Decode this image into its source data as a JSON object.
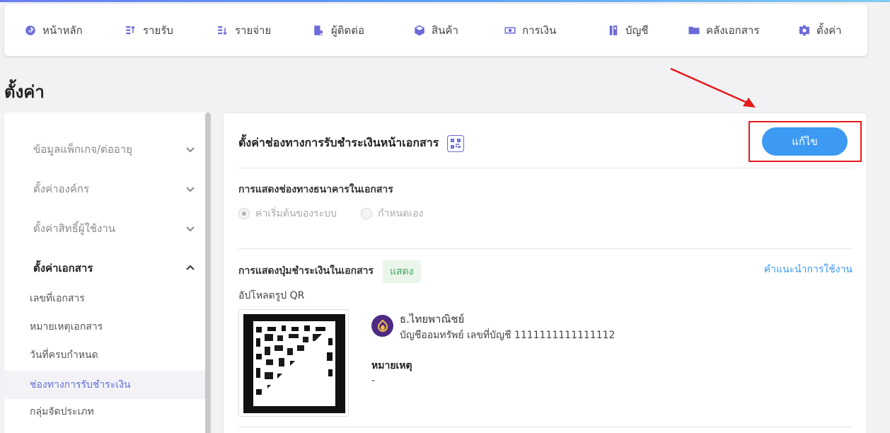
{
  "nav": {
    "items": [
      {
        "label": "หน้าหลัก",
        "icon": "dashboard-icon"
      },
      {
        "label": "รายรับ",
        "icon": "income-icon"
      },
      {
        "label": "รายจ่าย",
        "icon": "expense-icon"
      },
      {
        "label": "ผู้ติดต่อ",
        "icon": "contacts-icon"
      },
      {
        "label": "สินค้า",
        "icon": "box-icon"
      },
      {
        "label": "การเงิน",
        "icon": "money-icon"
      },
      {
        "label": "บัญชี",
        "icon": "ledger-icon"
      },
      {
        "label": "คลังเอกสาร",
        "icon": "folder-icon"
      },
      {
        "label": "ตั้งค่า",
        "icon": "gear-icon"
      }
    ]
  },
  "page": {
    "title": "ตั้งค่า"
  },
  "sidebar": {
    "groups": [
      {
        "label": "ข้อมูลแพ็กเกจ/ต่ออายุ",
        "expanded": false
      },
      {
        "label": "ตั้งค่าองค์กร",
        "expanded": false
      },
      {
        "label": "ตั้งค่าสิทธิ์ผู้ใช้งาน",
        "expanded": false
      },
      {
        "label": "ตั้งค่าเอกสาร",
        "expanded": true
      }
    ],
    "sub_items": [
      {
        "label": "เลขที่เอกสาร"
      },
      {
        "label": "หมายเหตุเอกสาร"
      },
      {
        "label": "วันที่ครบกำหนด"
      },
      {
        "label": "ช่องทางการรับชำระเงิน",
        "selected": true
      },
      {
        "label": "กลุ่มจัดประเภท"
      }
    ]
  },
  "card": {
    "title": "ตั้งค่าช่องทางการรับชำระเงินหน้าเอกสาร",
    "edit_label": "แก้ไข",
    "bank_section": {
      "label": "การแสดงช่องทางธนาคารในเอกสาร",
      "options": [
        {
          "label": "ค่าเริ่มต้นของระบบ",
          "checked": true
        },
        {
          "label": "กำหนดเอง",
          "checked": false
        }
      ]
    },
    "payment_section": {
      "label": "การแสดงปุ่มชำระเงินในเอกสาร",
      "badge": "แสดง",
      "help_link": "คำแนะนำการใช้งาน",
      "upload_label": "อัปโหลดรูป QR"
    },
    "bank": {
      "name": "ธ.ไทยพาณิชย์",
      "account": "บัญชีออมทรัพย์ เลขที่บัญชี 1111111111111112",
      "note_label": "หมายเหตุ",
      "note_value": "-"
    }
  },
  "colors": {
    "accent": "#3d9af2",
    "icon": "#6a6ad8",
    "highlight": "#e41a1a",
    "badge_text": "#43a659",
    "bank_logo": "#4e2a84"
  }
}
